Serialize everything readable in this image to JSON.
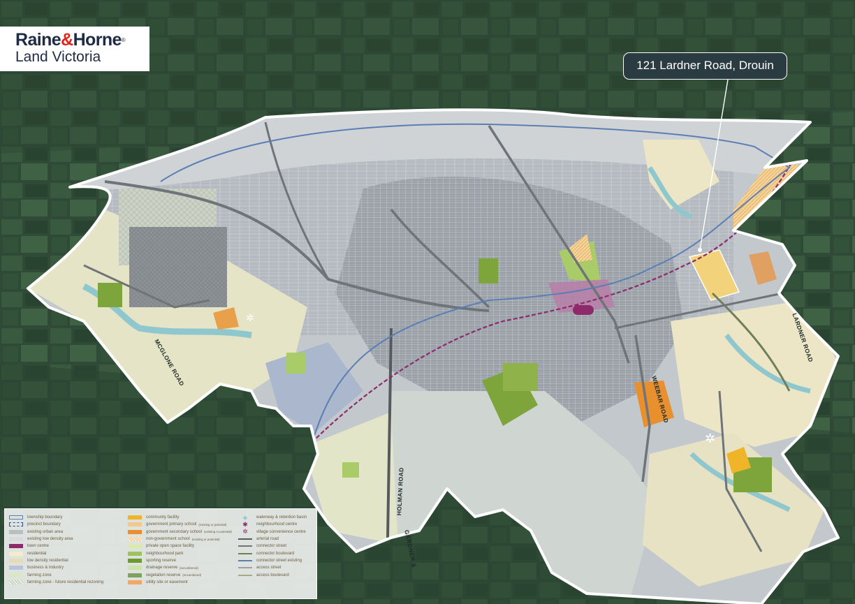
{
  "logo": {
    "brand_part1": "Raine",
    "brand_amp": "&",
    "brand_part2": "Horne",
    "brand_reg": "®",
    "sub": "Land Victoria"
  },
  "callout": {
    "label": "121 Lardner Road, Drouin"
  },
  "streets": {
    "mcglone": "MCGLONE ROAD",
    "lardner": "LARDNER ROAD",
    "weebar": "WEEBAR ROAD",
    "holman": "HOLMAN ROAD",
    "gardner": "GARDNER &"
  },
  "legend": {
    "col1": [
      {
        "label": "township boundary",
        "color": "#5b7fb5",
        "kind": "outline"
      },
      {
        "label": "precinct boundary",
        "color": "#2a4d8f",
        "kind": "dashed"
      },
      {
        "label": "existing urban area",
        "color": "#b9bdc4",
        "kind": "fill"
      },
      {
        "label": "existing low density area",
        "color": "#d8dadd",
        "kind": "fill"
      },
      {
        "label": "town centre",
        "color": "#8e2a6b",
        "kind": "fill"
      },
      {
        "label": "residential",
        "color": "#f3edcc",
        "kind": "fill"
      },
      {
        "label": "low density residential",
        "color": "#e7dbb4",
        "kind": "fill"
      },
      {
        "label": "business & industry",
        "color": "#b9c4d8",
        "kind": "fill"
      },
      {
        "label": "farming zone",
        "color": "#dbe6c4",
        "kind": "fill"
      },
      {
        "label": "farming zone - future residential rezoning",
        "color": "#c9d3bd",
        "kind": "hatch"
      }
    ],
    "col2": [
      {
        "label": "community facility",
        "sub": "",
        "color": "#f0b428",
        "kind": "fill"
      },
      {
        "label": "government primary school",
        "sub": "(existing or potential)",
        "color": "#f3c88a",
        "kind": "fill"
      },
      {
        "label": "government secondary school",
        "sub": "(existing or potential)",
        "color": "#e8902e",
        "kind": "fill"
      },
      {
        "label": "non-government school",
        "sub": "(existing or potential)",
        "color": "#f5cf9a",
        "kind": "hatch"
      },
      {
        "label": "private open space facility",
        "sub": "",
        "color": "#dce8b0",
        "kind": "fill"
      },
      {
        "label": "neighbourhood park",
        "sub": "",
        "color": "#9cc45a",
        "kind": "fill"
      },
      {
        "label": "sporting reserve",
        "sub": "",
        "color": "#6e9a32",
        "kind": "fill"
      },
      {
        "label": "drainage reserve",
        "sub": "(encumbered)",
        "color": "#cfe2a8",
        "kind": "fill"
      },
      {
        "label": "vegetation reserve",
        "sub": "(encumbered)",
        "color": "#7fa35c",
        "kind": "fill"
      },
      {
        "label": "utility site or easement",
        "sub": "",
        "color": "#f0a868",
        "kind": "fill"
      }
    ],
    "col3": [
      {
        "label": "waterway & retention basin",
        "color": "#7ec8d8",
        "kind": "glyph",
        "glyph": "◈"
      },
      {
        "label": "neighbourhood centre",
        "color": "#8e2a6b",
        "kind": "glyph",
        "glyph": "✱"
      },
      {
        "label": "village convenience centre",
        "color": "#8e2a6b",
        "kind": "glyph",
        "glyph": "✲"
      },
      {
        "label": "arterial road",
        "color": "#555a5f",
        "kind": "road"
      },
      {
        "label": "connector street",
        "color": "#6f7478",
        "kind": "road"
      },
      {
        "label": "connector boulevard",
        "color": "#6f7f5a",
        "kind": "road"
      },
      {
        "label": "connector street existing",
        "color": "#5d7fb0",
        "kind": "road"
      },
      {
        "label": "access street",
        "color": "#9aa0a4",
        "kind": "road"
      },
      {
        "label": "access boulevard",
        "color": "#9fb07a",
        "kind": "road"
      }
    ]
  },
  "colors": {
    "satellite": "#2f4a37",
    "urban": "#b6bcc2",
    "urban_dense": "#9ea4aa",
    "residential": "#efe8c8",
    "farming": "#dde6c2",
    "business": "#aab7cc",
    "town_centre": "#8e2a6b",
    "railway": "#8e2a6b",
    "arterial": "#5a5f63",
    "township_boundary": "#5b7fb5",
    "subject_site": "#f2d27a",
    "secondary_school": "#e8902e",
    "sporting_reserve": "#7ea43c",
    "neighbourhood_park": "#a9cc68"
  }
}
